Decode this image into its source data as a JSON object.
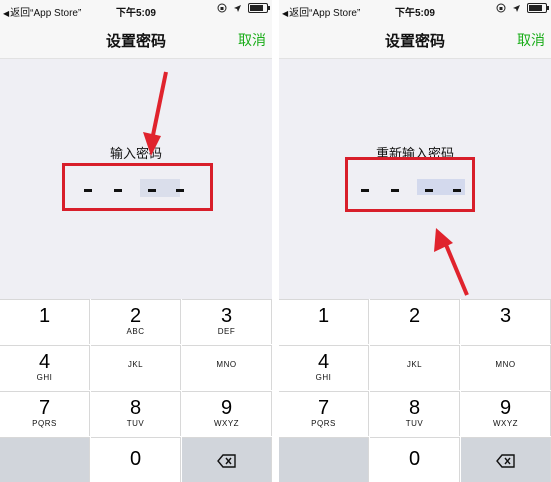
{
  "screens": [
    {
      "status": {
        "back_text": "返回“App Store”",
        "time": "下午5:09"
      },
      "nav": {
        "title": "设置密码",
        "cancel": "取消"
      },
      "prompt": "输入密码",
      "keypad": {
        "keys": [
          {
            "digit": "1",
            "letters": ""
          },
          {
            "digit": "2",
            "letters": "ABC"
          },
          {
            "digit": "3",
            "letters": "DEF"
          },
          {
            "digit": "4",
            "letters": "GHI"
          },
          {
            "digit": "",
            "letters": "JKL"
          },
          {
            "digit": "",
            "letters": "MNO"
          },
          {
            "digit": "7",
            "letters": "PQRS"
          },
          {
            "digit": "8",
            "letters": "TUV"
          },
          {
            "digit": "9",
            "letters": "WXYZ"
          },
          {
            "digit": "0",
            "letters": ""
          }
        ]
      }
    },
    {
      "status": {
        "back_text": "返回“App Store”",
        "time": "下午5:09"
      },
      "nav": {
        "title": "设置密码",
        "cancel": "取消"
      },
      "prompt": "重新输入密码",
      "keypad": {
        "keys": [
          {
            "digit": "1",
            "letters": ""
          },
          {
            "digit": "2",
            "letters": ""
          },
          {
            "digit": "3",
            "letters": ""
          },
          {
            "digit": "4",
            "letters": "GHI"
          },
          {
            "digit": "",
            "letters": "JKL"
          },
          {
            "digit": "",
            "letters": "MNO"
          },
          {
            "digit": "7",
            "letters": "PQRS"
          },
          {
            "digit": "8",
            "letters": "TUV"
          },
          {
            "digit": "9",
            "letters": "WXYZ"
          },
          {
            "digit": "0",
            "letters": ""
          }
        ]
      }
    }
  ],
  "icons": {
    "signal": "location-arrow-icon",
    "lock": "rotation-lock-icon",
    "battery": "battery-icon",
    "delete": "backspace-icon"
  },
  "colors": {
    "accent": "#1aad19",
    "highlight_box": "#d81e2a",
    "arrow": "#e0232d",
    "keypad_gray": "#d1d5db"
  }
}
